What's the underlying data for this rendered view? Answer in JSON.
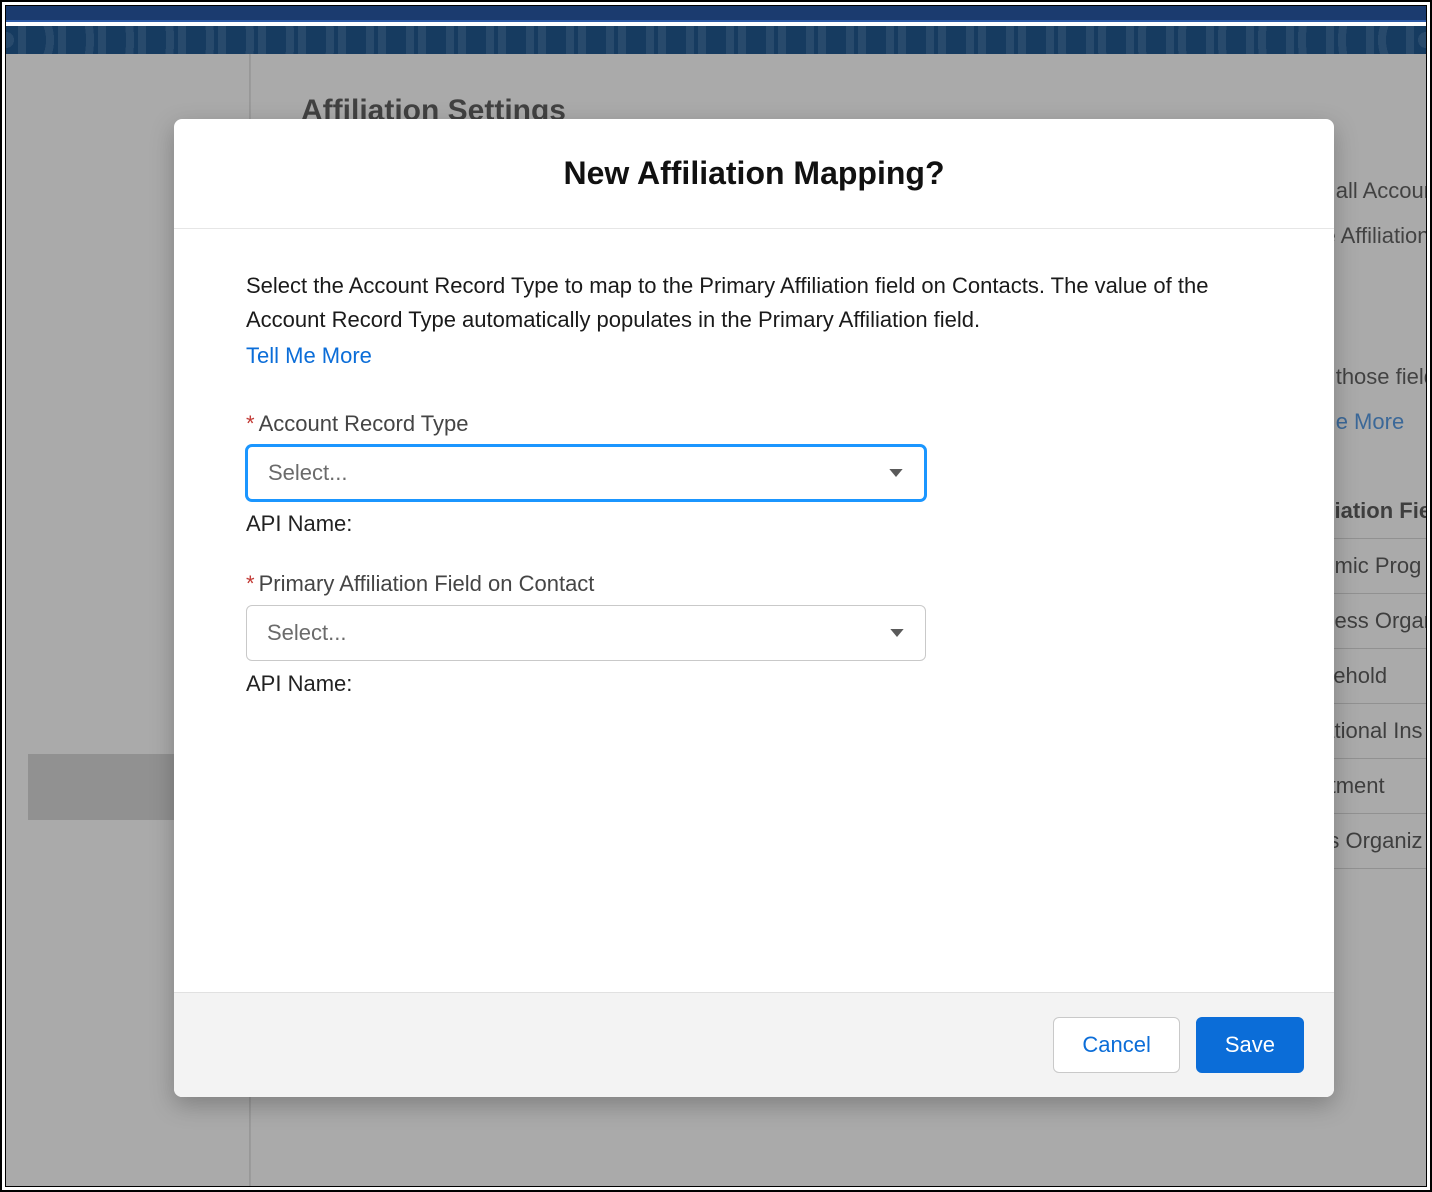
{
  "background": {
    "page_title": "Affiliation Settings",
    "paragraph1_frag_right_1": "t all Accoun",
    "paragraph1_frag_right_2": "e Affiliation",
    "paragraph2_frag_right_1": "those field",
    "tell_me_more_frag": "e More",
    "table_header_frag": "iliation Fie",
    "rows": [
      "emic Prog",
      "ness Organ",
      "sehold",
      "ational Ins",
      "rtment",
      "ts Organiz"
    ]
  },
  "modal": {
    "title": "New Affiliation Mapping?",
    "help_text": "Select the Account Record Type to map to the Primary Affiliation field on Contacts. The value of the Account Record Type automatically populates in the Primary Affiliation field.",
    "tell_me_more": "Tell Me More",
    "field1": {
      "label": "Account Record Type",
      "placeholder": "Select...",
      "api_name_label": "API Name:"
    },
    "field2": {
      "label": "Primary Affiliation Field on Contact",
      "placeholder": "Select...",
      "api_name_label": "API Name:"
    },
    "cancel": "Cancel",
    "save": "Save"
  },
  "colors": {
    "brand_dark": "#163b60",
    "link": "#0b6dd8",
    "focus": "#1b96ff",
    "required": "#c23934"
  }
}
